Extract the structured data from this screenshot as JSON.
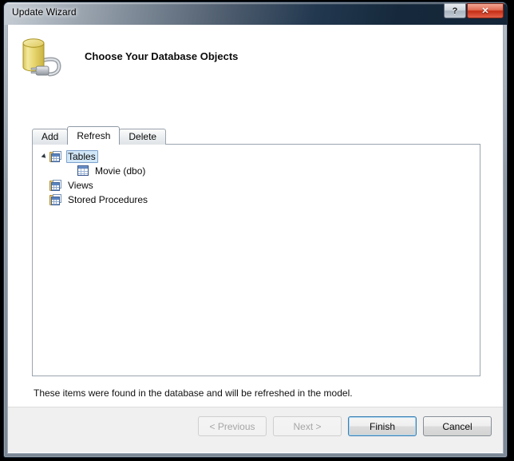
{
  "window": {
    "title": "Update Wizard",
    "help_button": "?",
    "close_button": "✕"
  },
  "header": {
    "heading": "Choose Your Database Objects",
    "icon": "database-plug-icon"
  },
  "tabs": [
    {
      "label": "Add",
      "selected": false
    },
    {
      "label": "Refresh",
      "selected": true
    },
    {
      "label": "Delete",
      "selected": false
    }
  ],
  "tree": {
    "nodes": [
      {
        "label": "Tables",
        "icon": "folder-grid-icon",
        "level": 0,
        "expanded": true,
        "selected": true
      },
      {
        "label": "Movie (dbo)",
        "icon": "table-icon",
        "level": 1,
        "expanded": false,
        "selected": false
      },
      {
        "label": "Views",
        "icon": "folder-grid-icon",
        "level": 0,
        "expanded": false,
        "selected": false
      },
      {
        "label": "Stored Procedures",
        "icon": "folder-grid-icon",
        "level": 0,
        "expanded": false,
        "selected": false
      }
    ]
  },
  "footer": {
    "description": "These items were found in the database and will be refreshed in the model."
  },
  "buttons": [
    {
      "label": "< Previous",
      "state": "disabled"
    },
    {
      "label": "Next >",
      "state": "disabled"
    },
    {
      "label": "Finish",
      "state": "default"
    },
    {
      "label": "Cancel",
      "state": "normal"
    }
  ],
  "colors": {
    "titlebar_start": "#c8ced5",
    "titlebar_end": "#132537",
    "close_button": "#c52d14",
    "selection_fill": "#d2e7f7",
    "selection_border": "#7da2ce",
    "default_button_border": "#3c7fb1",
    "footer_bg": "#f0f0f0"
  }
}
